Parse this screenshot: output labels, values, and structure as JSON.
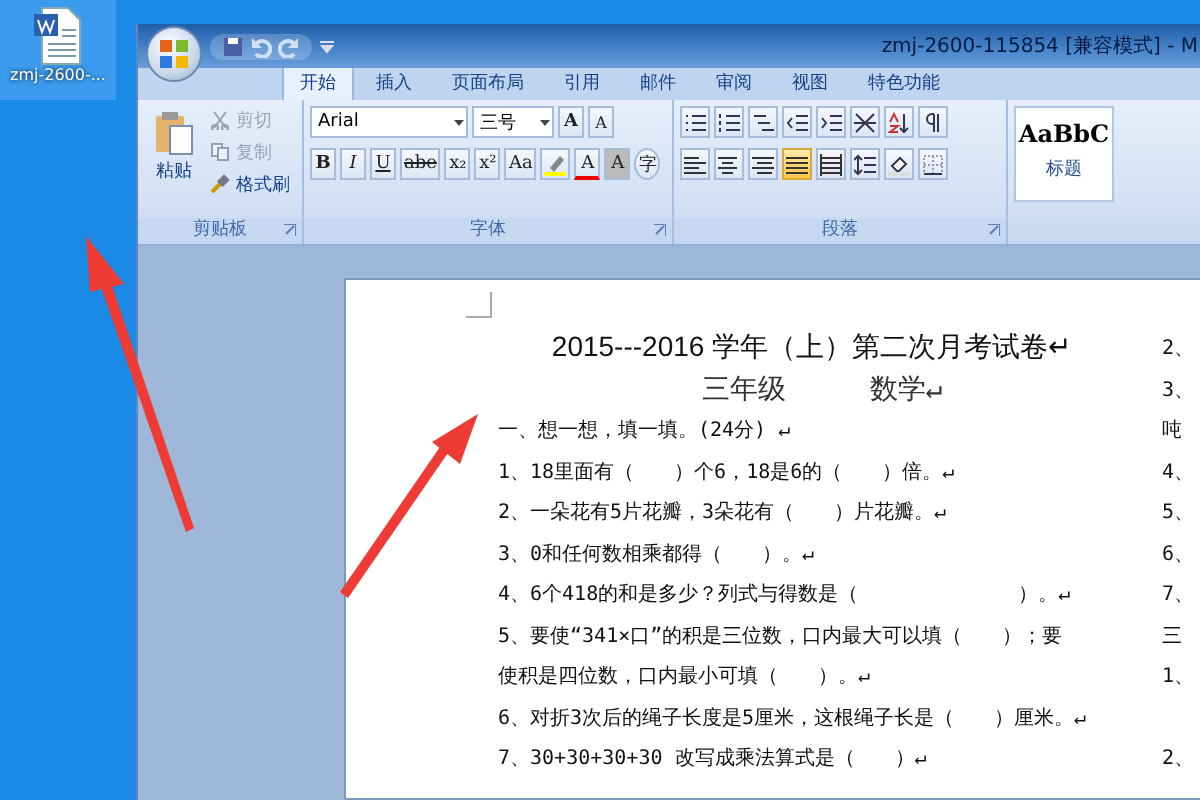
{
  "desktop_icon": {
    "label": "zmj-2600-..."
  },
  "window": {
    "title": "zmj-2600-115854 [兼容模式] - M"
  },
  "tabs": [
    {
      "label": "开始",
      "selected": true
    },
    {
      "label": "插入",
      "selected": false
    },
    {
      "label": "页面布局",
      "selected": false
    },
    {
      "label": "引用",
      "selected": false
    },
    {
      "label": "邮件",
      "selected": false
    },
    {
      "label": "审阅",
      "selected": false
    },
    {
      "label": "视图",
      "selected": false
    },
    {
      "label": "特色功能",
      "selected": false
    }
  ],
  "clipboard": {
    "paste": "粘贴",
    "group_label": "剪贴板",
    "items": [
      {
        "kind": "cut",
        "label": "剪切",
        "disabled": true
      },
      {
        "kind": "copy",
        "label": "复制",
        "disabled": true
      },
      {
        "kind": "brush",
        "label": "格式刷",
        "disabled": false
      }
    ]
  },
  "font": {
    "name": "Arial",
    "size": "三号",
    "group_label": "字体",
    "grow": "A",
    "shrink": "A",
    "color_button": "A",
    "shading_button": "A",
    "enclose_button": "字",
    "buttons": [
      {
        "kind": "bold",
        "label": "B"
      },
      {
        "kind": "italic",
        "label": "I"
      },
      {
        "kind": "underline",
        "label": "U"
      },
      {
        "kind": "strike",
        "label": "abe"
      },
      {
        "kind": "sub",
        "label": "x₂"
      },
      {
        "kind": "sup",
        "label": "x²"
      },
      {
        "kind": "case",
        "label": "Aa"
      }
    ]
  },
  "paragraph": {
    "group_label": "段落",
    "align": [
      {
        "kind": "left",
        "selected": false
      },
      {
        "kind": "center",
        "selected": false
      },
      {
        "kind": "right",
        "selected": false
      },
      {
        "kind": "justify",
        "selected": true
      },
      {
        "kind": "distributed",
        "selected": false
      }
    ]
  },
  "styles": {
    "preview": "AaBbC",
    "label": "标题"
  },
  "document": {
    "lines": [
      {
        "kind": "title",
        "text": "2015---2016 学年（上）第二次月考试卷↵",
        "side": "2、"
      },
      {
        "kind": "subtitle",
        "text": "三年级　　　数学↵",
        "side": "3、"
      },
      {
        "kind": "body",
        "text": "一、想一想，填一填。(24分) ↵",
        "side": "吨"
      },
      {
        "kind": "body",
        "text": "1、18里面有（　　）个6，18是6的（　　）倍。↵",
        "side": "4、"
      },
      {
        "kind": "body",
        "text": "2、一朵花有5片花瓣，3朵花有（　　）片花瓣。↵",
        "side": "5、"
      },
      {
        "kind": "body",
        "text": "3、0和任何数相乘都得（　　）。↵",
        "side": "6、"
      },
      {
        "kind": "body",
        "text": "4、6个418的和是多少？列式与得数是（　　　　　　　　）。↵",
        "side": "7、"
      },
      {
        "kind": "body",
        "text": "5、要使“341×口”的积是三位数，口内最大可以填（　　）；要",
        "side": "三"
      },
      {
        "kind": "body",
        "text": "使积是四位数，口内最小可填（　　）。↵",
        "side": "1、"
      },
      {
        "kind": "body",
        "text": "6、对折3次后的绳子长度是5厘米，这根绳子长是（　　）厘米。↵"
      },
      {
        "kind": "body",
        "text": "7、30+30+30+30 改写成乘法算式是（　　）↵",
        "side": "2、"
      }
    ]
  }
}
